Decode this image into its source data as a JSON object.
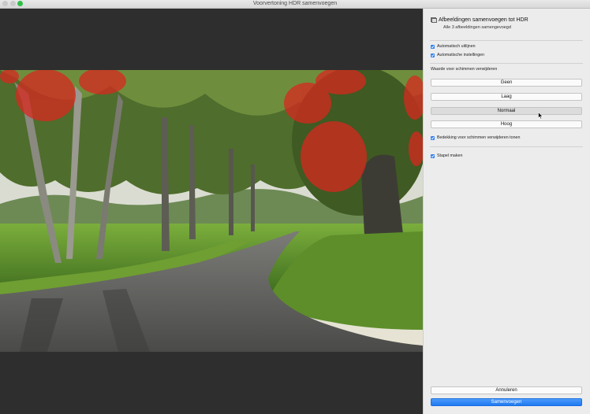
{
  "window": {
    "title": "Voorvertoning HDR samenvoegen"
  },
  "panel": {
    "title": "Afbeeldingen samenvoegen tot HDR",
    "subtitle": "Alle 3 afbeeldingen samengevoegd",
    "auto_align": {
      "label": "Automatisch uitlijnen",
      "checked": true
    },
    "auto_settings": {
      "label": "Automatische instellingen",
      "checked": true
    },
    "deghost_label": "Waarde voor schimmen verwijderen",
    "deghost_options": [
      "Geen",
      "Laag",
      "Normaal",
      "Hoog"
    ],
    "deghost_selected": "Normaal",
    "show_overlay": {
      "label": "Bedekking voor schimmen verwijderen tonen",
      "checked": true
    },
    "create_stack": {
      "label": "Stapel maken",
      "checked": true
    },
    "cancel_label": "Annuleren",
    "merge_label": "Samenvoegen"
  },
  "colors": {
    "accent": "#2f7ff0",
    "ghost_overlay": "#d8281f"
  }
}
